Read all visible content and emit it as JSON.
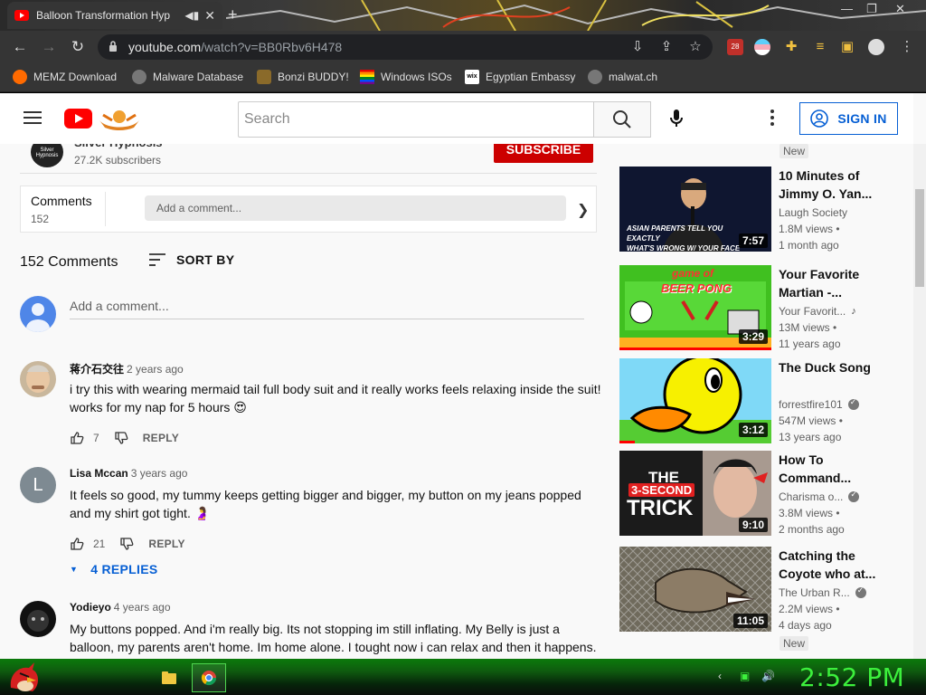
{
  "browser": {
    "tab_title": "Balloon Transformation Hyp",
    "tab_close": "✕",
    "new_tab": "+",
    "url_host": "youtube.com",
    "url_path": "/watch?v=BB0Rbv6H478",
    "extension_badge": "28"
  },
  "bookmarks": [
    {
      "label": "MEMZ Download",
      "icon": "flame-icon",
      "color": "#ff6a00"
    },
    {
      "label": "Malware Database",
      "icon": "globe-icon",
      "color": "#777777"
    },
    {
      "label": "Bonzi BUDDY!",
      "icon": "bonzi-icon",
      "color": "#8a6a2a"
    },
    {
      "label": "Windows ISOs",
      "icon": "rainbow-flag-icon",
      "color": "#ff0000"
    },
    {
      "label": "Egyptian Embassy",
      "icon": "wix-icon",
      "color": "#ffffff"
    },
    {
      "label": "malwat.ch",
      "icon": "globe-icon",
      "color": "#777777"
    }
  ],
  "youtube": {
    "search_placeholder": "Search",
    "sign_in": "SIGN IN",
    "channel": {
      "name": "Silver Hypnosis",
      "subscribers": "27.2K subscribers",
      "avatar_text": "Silver Hypnosis",
      "subscribe": "SUBSCRIBE"
    },
    "comments_box": {
      "label": "Comments",
      "count": "152",
      "add_placeholder": "Add a comment..."
    },
    "comments_header": "152 Comments",
    "sort_by": "SORT BY",
    "add_comment_placeholder": "Add a comment...",
    "comments": [
      {
        "author": "蒋介石交往",
        "time": "2 years ago",
        "text": "i try this with wearing mermaid tail full body suit and it really works feels relaxing inside the suit! works for my nap for 5 hours 😍",
        "likes": "7",
        "reply": "REPLY"
      },
      {
        "author": "Lisa Mccan",
        "time": "3 years ago",
        "avatar_letter": "L",
        "text": "It feels so good, my tummy keeps getting bigger and bigger, my button on my jeans popped and my shirt got tight.  🤰",
        "likes": "21",
        "reply": "REPLY",
        "replies": "4 REPLIES"
      },
      {
        "author": "Yodieyo",
        "time": "4 years ago",
        "text": "My buttons popped. And i'm really big. Its not stopping im still inflating. My Belly is just a balloon, my parents aren't home. Im home alone. I tought now i can relax and then it happens."
      }
    ],
    "sidebar_new_top": "New",
    "sidebar_new_bottom": "New",
    "recommendations": [
      {
        "title": "10 Minutes of Jimmy O. Yan...",
        "channel": "Laugh Society",
        "views": "1.8M views •",
        "age": "1 month ago",
        "duration": "7:57",
        "thumb_caption_1": "ASIAN PARENTS TELL YOU EXACTLY",
        "thumb_caption_2": "WHAT'S WRONG W/ YOUR FACE",
        "verified": false,
        "music": false
      },
      {
        "title": "Your Favorite Martian -...",
        "channel": "Your Favorit...",
        "views": "13M views •",
        "age": "11 years ago",
        "duration": "3:29",
        "thumb_caption_1": "game of",
        "thumb_caption_2": "BEER PONG",
        "verified": false,
        "music": true,
        "progress": 1.0
      },
      {
        "title": "The Duck Song",
        "channel": "forrestfire101",
        "views": "547M views •",
        "age": "13 years ago",
        "duration": "3:12",
        "verified": true,
        "music": false,
        "progress": 0.1
      },
      {
        "title": "How To Command...",
        "channel": "Charisma o...",
        "views": "3.8M views •",
        "age": "2 months ago",
        "duration": "9:10",
        "thumb_caption_1": "THE",
        "thumb_caption_2": "3-SECOND",
        "thumb_caption_3": "TRICK",
        "verified": true,
        "music": false
      },
      {
        "title": "Catching the Coyote who at...",
        "channel": "The Urban R...",
        "views": "2.2M views •",
        "age": "4 days ago",
        "duration": "11:05",
        "verified": true,
        "music": false
      }
    ]
  },
  "taskbar": {
    "clock": "2:52 PM"
  },
  "colors": {
    "youtube_red": "#ff0000",
    "link_blue": "#065fd4",
    "taskbar_green": "#0b7a0b",
    "clock_green": "#3cf03c"
  }
}
